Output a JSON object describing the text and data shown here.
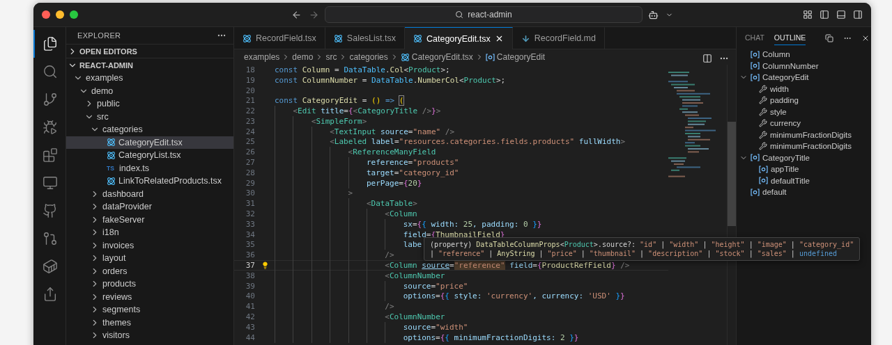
{
  "title_bar": {
    "search": "react-admin"
  },
  "activity_bar": [
    {
      "kind": "explorer",
      "selected": true
    },
    {
      "kind": "search",
      "selected": false
    },
    {
      "kind": "source_control",
      "selected": false
    },
    {
      "kind": "run_debug",
      "selected": false
    },
    {
      "kind": "extensions",
      "selected": false
    },
    {
      "kind": "remote",
      "selected": false
    },
    {
      "kind": "github",
      "selected": false
    },
    {
      "kind": "pull_requests",
      "selected": false
    },
    {
      "kind": "docker",
      "selected": false
    },
    {
      "kind": "live_share",
      "selected": false
    }
  ],
  "sidebar": {
    "title": "EXPLORER",
    "sections": [
      {
        "label": "OPEN EDITORS",
        "expanded": false
      },
      {
        "label": "REACT-ADMIN",
        "expanded": true,
        "children": [
          {
            "label": "examples",
            "kind": "folder",
            "expanded": true,
            "selected": false,
            "children": [
              {
                "label": "demo",
                "kind": "folder",
                "expanded": true,
                "selected": false,
                "children": [
                  {
                    "label": "public",
                    "kind": "folder",
                    "expanded": false,
                    "selected": false
                  },
                  {
                    "label": "src",
                    "kind": "folder",
                    "expanded": true,
                    "selected": false,
                    "children": [
                      {
                        "label": "categories",
                        "kind": "folder",
                        "expanded": true,
                        "selected": false,
                        "children": [
                          {
                            "label": "CategoryEdit.tsx",
                            "kind": "react",
                            "selected": true
                          },
                          {
                            "label": "CategoryList.tsx",
                            "kind": "react",
                            "selected": false
                          },
                          {
                            "label": "index.ts",
                            "kind": "ts",
                            "badge": "TS",
                            "selected": false
                          },
                          {
                            "label": "LinkToRelatedProducts.tsx",
                            "kind": "react",
                            "selected": false
                          }
                        ]
                      },
                      {
                        "label": "dashboard",
                        "kind": "folder",
                        "expanded": false,
                        "selected": false
                      },
                      {
                        "label": "dataProvider",
                        "kind": "folder",
                        "expanded": false,
                        "selected": false
                      },
                      {
                        "label": "fakeServer",
                        "kind": "folder",
                        "expanded": false,
                        "selected": false
                      },
                      {
                        "label": "i18n",
                        "kind": "folder",
                        "expanded": false,
                        "selected": false
                      },
                      {
                        "label": "invoices",
                        "kind": "folder",
                        "expanded": false,
                        "selected": false
                      },
                      {
                        "label": "layout",
                        "kind": "folder",
                        "expanded": false,
                        "selected": false
                      },
                      {
                        "label": "orders",
                        "kind": "folder",
                        "expanded": false,
                        "selected": false
                      },
                      {
                        "label": "products",
                        "kind": "folder",
                        "expanded": false,
                        "selected": false
                      },
                      {
                        "label": "reviews",
                        "kind": "folder",
                        "expanded": false,
                        "selected": false
                      },
                      {
                        "label": "segments",
                        "kind": "folder",
                        "expanded": false,
                        "selected": false
                      },
                      {
                        "label": "themes",
                        "kind": "folder",
                        "expanded": false,
                        "selected": false
                      },
                      {
                        "label": "visitors",
                        "kind": "folder",
                        "expanded": false,
                        "selected": false
                      }
                    ]
                  }
                ]
              }
            ]
          }
        ]
      }
    ]
  },
  "tabs": [
    {
      "label": "RecordField.tsx",
      "kind": "react",
      "selected": false
    },
    {
      "label": "SalesList.tsx",
      "kind": "react",
      "selected": false
    },
    {
      "label": "CategoryEdit.tsx",
      "kind": "react",
      "selected": true
    },
    {
      "label": "RecordField.md",
      "kind": "markdown",
      "selected": false
    }
  ],
  "breadcrumbs": [
    {
      "label": "examples",
      "kind": "folder"
    },
    {
      "label": "demo",
      "kind": "folder"
    },
    {
      "label": "src",
      "kind": "folder"
    },
    {
      "label": "categories",
      "kind": "folder"
    },
    {
      "label": "CategoryEdit.tsx",
      "kind": "react"
    },
    {
      "label": "CategoryEdit",
      "kind": "symbol"
    }
  ],
  "code": {
    "lines": [
      {
        "number": "18",
        "current": false,
        "tokens": [
          {
            "text": "const ",
            "kind": "kw"
          },
          {
            "text": "Column",
            "kind": "var"
          },
          {
            "text": " = ",
            "kind": "p"
          },
          {
            "text": "DataTable",
            "kind": "obj"
          },
          {
            "text": ".",
            "kind": "p"
          },
          {
            "text": "Col",
            "kind": "var"
          },
          {
            "text": "<",
            "kind": "p"
          },
          {
            "text": "Product",
            "kind": "type"
          },
          {
            "text": ">;",
            "kind": "p"
          }
        ]
      },
      {
        "number": "19",
        "current": false,
        "tokens": [
          {
            "text": "const ",
            "kind": "kw"
          },
          {
            "text": "ColumnNumber",
            "kind": "var"
          },
          {
            "text": " = ",
            "kind": "p"
          },
          {
            "text": "DataTable",
            "kind": "obj"
          },
          {
            "text": ".",
            "kind": "p"
          },
          {
            "text": "NumberCol",
            "kind": "var"
          },
          {
            "text": "<",
            "kind": "p"
          },
          {
            "text": "Product",
            "kind": "type"
          },
          {
            "text": ">;",
            "kind": "p"
          }
        ]
      },
      {
        "number": "20",
        "current": false
      },
      {
        "number": "21",
        "current": false,
        "tokens": [
          {
            "text": "const ",
            "kind": "kw"
          },
          {
            "text": "CategoryEdit",
            "kind": "var"
          },
          {
            "text": " = ",
            "kind": "p"
          },
          {
            "text": "()",
            "kind": "b1"
          },
          {
            "text": " => ",
            "kind": "kw"
          },
          {
            "text": "(",
            "kind": "b1_match"
          }
        ],
        "children": [
          {
            "number": "22",
            "current": false,
            "tokens": [
              {
                "text": "<",
                "kind": "tp"
              },
              {
                "text": "Edit",
                "kind": "tag"
              },
              {
                "text": " title",
                "kind": "attr"
              },
              {
                "text": "=",
                "kind": "p"
              },
              {
                "text": "{",
                "kind": "b2"
              },
              {
                "text": "<",
                "kind": "tp"
              },
              {
                "text": "CategoryTitle",
                "kind": "tag"
              },
              {
                "text": " />",
                "kind": "tp"
              },
              {
                "text": "}",
                "kind": "b2"
              },
              {
                "text": ">",
                "kind": "tp"
              }
            ],
            "children": [
              {
                "number": "23",
                "current": false,
                "tokens": [
                  {
                    "text": "<",
                    "kind": "tp"
                  },
                  {
                    "text": "SimpleForm",
                    "kind": "tag"
                  },
                  {
                    "text": ">",
                    "kind": "tp"
                  }
                ],
                "children": [
                  {
                    "number": "24",
                    "current": false,
                    "tokens": [
                      {
                        "text": "<",
                        "kind": "tp"
                      },
                      {
                        "text": "TextInput",
                        "kind": "tag"
                      },
                      {
                        "text": " source",
                        "kind": "attr"
                      },
                      {
                        "text": "=",
                        "kind": "p"
                      },
                      {
                        "text": "\"name\"",
                        "kind": "str"
                      },
                      {
                        "text": " />",
                        "kind": "tp"
                      }
                    ]
                  },
                  {
                    "number": "25",
                    "current": false,
                    "tokens": [
                      {
                        "text": "<",
                        "kind": "tp"
                      },
                      {
                        "text": "Labeled",
                        "kind": "tag"
                      },
                      {
                        "text": " label",
                        "kind": "attr"
                      },
                      {
                        "text": "=",
                        "kind": "p"
                      },
                      {
                        "text": "\"resources.categories.fields.products\"",
                        "kind": "str"
                      },
                      {
                        "text": " fullWidth",
                        "kind": "attr"
                      },
                      {
                        "text": ">",
                        "kind": "tp"
                      }
                    ],
                    "children": [
                      {
                        "number": "26",
                        "current": false,
                        "tokens": [
                          {
                            "text": "<",
                            "kind": "tp"
                          },
                          {
                            "text": "ReferenceManyField",
                            "kind": "tag"
                          }
                        ],
                        "children": [
                          {
                            "number": "27",
                            "current": false,
                            "tokens": [
                              {
                                "text": "reference",
                                "kind": "attr"
                              },
                              {
                                "text": "=",
                                "kind": "p"
                              },
                              {
                                "text": "\"products\"",
                                "kind": "str"
                              }
                            ]
                          },
                          {
                            "number": "28",
                            "current": false,
                            "tokens": [
                              {
                                "text": "target",
                                "kind": "attr"
                              },
                              {
                                "text": "=",
                                "kind": "p"
                              },
                              {
                                "text": "\"category_id\"",
                                "kind": "str"
                              }
                            ]
                          },
                          {
                            "number": "29",
                            "current": false,
                            "tokens": [
                              {
                                "text": "perPage",
                                "kind": "attr"
                              },
                              {
                                "text": "=",
                                "kind": "p"
                              },
                              {
                                "text": "{",
                                "kind": "b2"
                              },
                              {
                                "text": "20",
                                "kind": "num"
                              },
                              {
                                "text": "}",
                                "kind": "b2"
                              }
                            ]
                          }
                        ]
                      },
                      {
                        "number": "30",
                        "current": false,
                        "tokens": [
                          {
                            "text": ">",
                            "kind": "tp"
                          }
                        ],
                        "children": [
                          {
                            "number": "31",
                            "current": false,
                            "tokens": [
                              {
                                "text": "<",
                                "kind": "tp"
                              },
                              {
                                "text": "DataTable",
                                "kind": "tag"
                              },
                              {
                                "text": ">",
                                "kind": "tp"
                              }
                            ],
                            "children": [
                              {
                                "number": "32",
                                "current": false,
                                "tokens": [
                                  {
                                    "text": "<",
                                    "kind": "tp"
                                  },
                                  {
                                    "text": "Column",
                                    "kind": "tag"
                                  }
                                ],
                                "children": [
                                  {
                                    "number": "33",
                                    "current": false,
                                    "tokens": [
                                      {
                                        "text": "sx",
                                        "kind": "attr"
                                      },
                                      {
                                        "text": "=",
                                        "kind": "p"
                                      },
                                      {
                                        "text": "{",
                                        "kind": "b2"
                                      },
                                      {
                                        "text": "{",
                                        "kind": "b3"
                                      },
                                      {
                                        "text": " width: ",
                                        "kind": "attr"
                                      },
                                      {
                                        "text": "25",
                                        "kind": "num"
                                      },
                                      {
                                        "text": ", padding: ",
                                        "kind": "attr"
                                      },
                                      {
                                        "text": "0",
                                        "kind": "num"
                                      },
                                      {
                                        "text": " }",
                                        "kind": "b3"
                                      },
                                      {
                                        "text": "}",
                                        "kind": "b2"
                                      }
                                    ]
                                  },
                                  {
                                    "number": "34",
                                    "current": false,
                                    "tokens": [
                                      {
                                        "text": "field",
                                        "kind": "attr"
                                      },
                                      {
                                        "text": "=",
                                        "kind": "p"
                                      },
                                      {
                                        "text": "{",
                                        "kind": "b2"
                                      },
                                      {
                                        "text": "ThumbnailField",
                                        "kind": "var"
                                      },
                                      {
                                        "text": "}",
                                        "kind": "b2"
                                      }
                                    ]
                                  },
                                  {
                                    "number": "35",
                                    "current": false,
                                    "tokens": [
                                      {
                                        "text": "labe",
                                        "kind": "attr"
                                      }
                                    ]
                                  }
                                ]
                              },
                              {
                                "number": "36",
                                "current": false,
                                "tokens": [
                                  {
                                    "text": "/>",
                                    "kind": "tp"
                                  }
                                ]
                              },
                              {
                                "number": "37",
                                "current": true,
                                "tokens": [
                                  {
                                    "text": "<",
                                    "kind": "tp"
                                  },
                                  {
                                    "text": "Column ",
                                    "kind": "tag"
                                  },
                                  {
                                    "text": "source",
                                    "kind": "attr_link"
                                  },
                                  {
                                    "text": "=",
                                    "kind": "p"
                                  },
                                  {
                                    "text": "\"reference\"",
                                    "kind": "str_match"
                                  },
                                  {
                                    "text": " field",
                                    "kind": "attr"
                                  },
                                  {
                                    "text": "=",
                                    "kind": "p"
                                  },
                                  {
                                    "text": "{",
                                    "kind": "b2"
                                  },
                                  {
                                    "text": "ProductRefField",
                                    "kind": "var"
                                  },
                                  {
                                    "text": "}",
                                    "kind": "b2"
                                  },
                                  {
                                    "text": " />",
                                    "kind": "tp"
                                  }
                                ]
                              },
                              {
                                "number": "38",
                                "current": false,
                                "tokens": [
                                  {
                                    "text": "<",
                                    "kind": "tp"
                                  },
                                  {
                                    "text": "ColumnNumber",
                                    "kind": "tag"
                                  }
                                ],
                                "children": [
                                  {
                                    "number": "39",
                                    "current": false,
                                    "tokens": [
                                      {
                                        "text": "source",
                                        "kind": "attr"
                                      },
                                      {
                                        "text": "=",
                                        "kind": "p"
                                      },
                                      {
                                        "text": "\"price\"",
                                        "kind": "str"
                                      }
                                    ]
                                  },
                                  {
                                    "number": "40",
                                    "current": false,
                                    "tokens": [
                                      {
                                        "text": "options",
                                        "kind": "attr"
                                      },
                                      {
                                        "text": "=",
                                        "kind": "p"
                                      },
                                      {
                                        "text": "{",
                                        "kind": "b2"
                                      },
                                      {
                                        "text": "{",
                                        "kind": "b3"
                                      },
                                      {
                                        "text": " style: ",
                                        "kind": "attr"
                                      },
                                      {
                                        "text": "'currency'",
                                        "kind": "str"
                                      },
                                      {
                                        "text": ", currency: ",
                                        "kind": "attr"
                                      },
                                      {
                                        "text": "'USD'",
                                        "kind": "str"
                                      },
                                      {
                                        "text": " }",
                                        "kind": "b3"
                                      },
                                      {
                                        "text": "}",
                                        "kind": "b2"
                                      }
                                    ]
                                  }
                                ]
                              },
                              {
                                "number": "41",
                                "current": false,
                                "tokens": [
                                  {
                                    "text": "/>",
                                    "kind": "tp"
                                  }
                                ]
                              },
                              {
                                "number": "42",
                                "current": false,
                                "tokens": [
                                  {
                                    "text": "<",
                                    "kind": "tp"
                                  },
                                  {
                                    "text": "ColumnNumber",
                                    "kind": "tag"
                                  }
                                ],
                                "children": [
                                  {
                                    "number": "43",
                                    "current": false,
                                    "tokens": [
                                      {
                                        "text": "source",
                                        "kind": "attr"
                                      },
                                      {
                                        "text": "=",
                                        "kind": "p"
                                      },
                                      {
                                        "text": "\"width\"",
                                        "kind": "str"
                                      }
                                    ]
                                  },
                                  {
                                    "number": "44",
                                    "current": false,
                                    "tokens": [
                                      {
                                        "text": "options",
                                        "kind": "attr"
                                      },
                                      {
                                        "text": "=",
                                        "kind": "p"
                                      },
                                      {
                                        "text": "{",
                                        "kind": "b2"
                                      },
                                      {
                                        "text": "{",
                                        "kind": "b3"
                                      },
                                      {
                                        "text": " minimumFractionDigits: ",
                                        "kind": "attr"
                                      },
                                      {
                                        "text": "2",
                                        "kind": "num"
                                      },
                                      {
                                        "text": " }",
                                        "kind": "b3"
                                      },
                                      {
                                        "text": "}",
                                        "kind": "b2"
                                      }
                                    ]
                                  }
                                ]
                              }
                            ]
                          }
                        ]
                      }
                    ]
                  }
                ]
              }
            ]
          }
        ]
      }
    ],
    "tooltip": [
      [
        {
          "text": "(property) ",
          "kind": "p"
        },
        {
          "text": "DataTableColumnProps",
          "kind": "var"
        },
        {
          "text": "<",
          "kind": "p"
        },
        {
          "text": "Product",
          "kind": "type"
        },
        {
          "text": ">.source?: ",
          "kind": "p"
        },
        {
          "text": "\"id\"",
          "kind": "str"
        },
        {
          "text": " | ",
          "kind": "p"
        },
        {
          "text": "\"width\"",
          "kind": "str"
        },
        {
          "text": " | ",
          "kind": "p"
        },
        {
          "text": "\"height\"",
          "kind": "str"
        },
        {
          "text": " | ",
          "kind": "p"
        },
        {
          "text": "\"image\"",
          "kind": "str"
        },
        {
          "text": " | ",
          "kind": "p"
        },
        {
          "text": "\"category_id\"",
          "kind": "str"
        }
      ],
      [
        {
          "text": "| ",
          "kind": "p"
        },
        {
          "text": "\"reference\"",
          "kind": "str"
        },
        {
          "text": " | ",
          "kind": "p"
        },
        {
          "text": "AnyString",
          "kind": "var"
        },
        {
          "text": " | ",
          "kind": "p"
        },
        {
          "text": "\"price\"",
          "kind": "str"
        },
        {
          "text": " | ",
          "kind": "p"
        },
        {
          "text": "\"thumbnail\"",
          "kind": "str"
        },
        {
          "text": " | ",
          "kind": "p"
        },
        {
          "text": "\"description\"",
          "kind": "str"
        },
        {
          "text": " | ",
          "kind": "p"
        },
        {
          "text": "\"stock\"",
          "kind": "str"
        },
        {
          "text": " | ",
          "kind": "p"
        },
        {
          "text": "\"sales\"",
          "kind": "str"
        },
        {
          "text": " | ",
          "kind": "p"
        },
        {
          "text": "undefined",
          "kind": "kw"
        }
      ]
    ]
  },
  "right_panel": {
    "tabs": [
      {
        "label": "CHAT",
        "selected": false
      },
      {
        "label": "OUTLINE",
        "selected": true
      }
    ],
    "outline": [
      {
        "label": "Column",
        "kind": "variable"
      },
      {
        "label": "ColumnNumber",
        "kind": "variable"
      },
      {
        "label": "CategoryEdit",
        "kind": "variable",
        "expanded": true,
        "children": [
          {
            "label": "width",
            "kind": "property"
          },
          {
            "label": "padding",
            "kind": "property"
          },
          {
            "label": "style",
            "kind": "property"
          },
          {
            "label": "currency",
            "kind": "property"
          },
          {
            "label": "minimumFractionDigits",
            "kind": "property"
          },
          {
            "label": "minimumFractionDigits",
            "kind": "property"
          }
        ]
      },
      {
        "label": "CategoryTitle",
        "kind": "variable",
        "expanded": true,
        "children": [
          {
            "label": "appTitle",
            "kind": "variable"
          },
          {
            "label": "defaultTitle",
            "kind": "variable"
          }
        ]
      },
      {
        "label": "default",
        "kind": "variable"
      }
    ]
  }
}
